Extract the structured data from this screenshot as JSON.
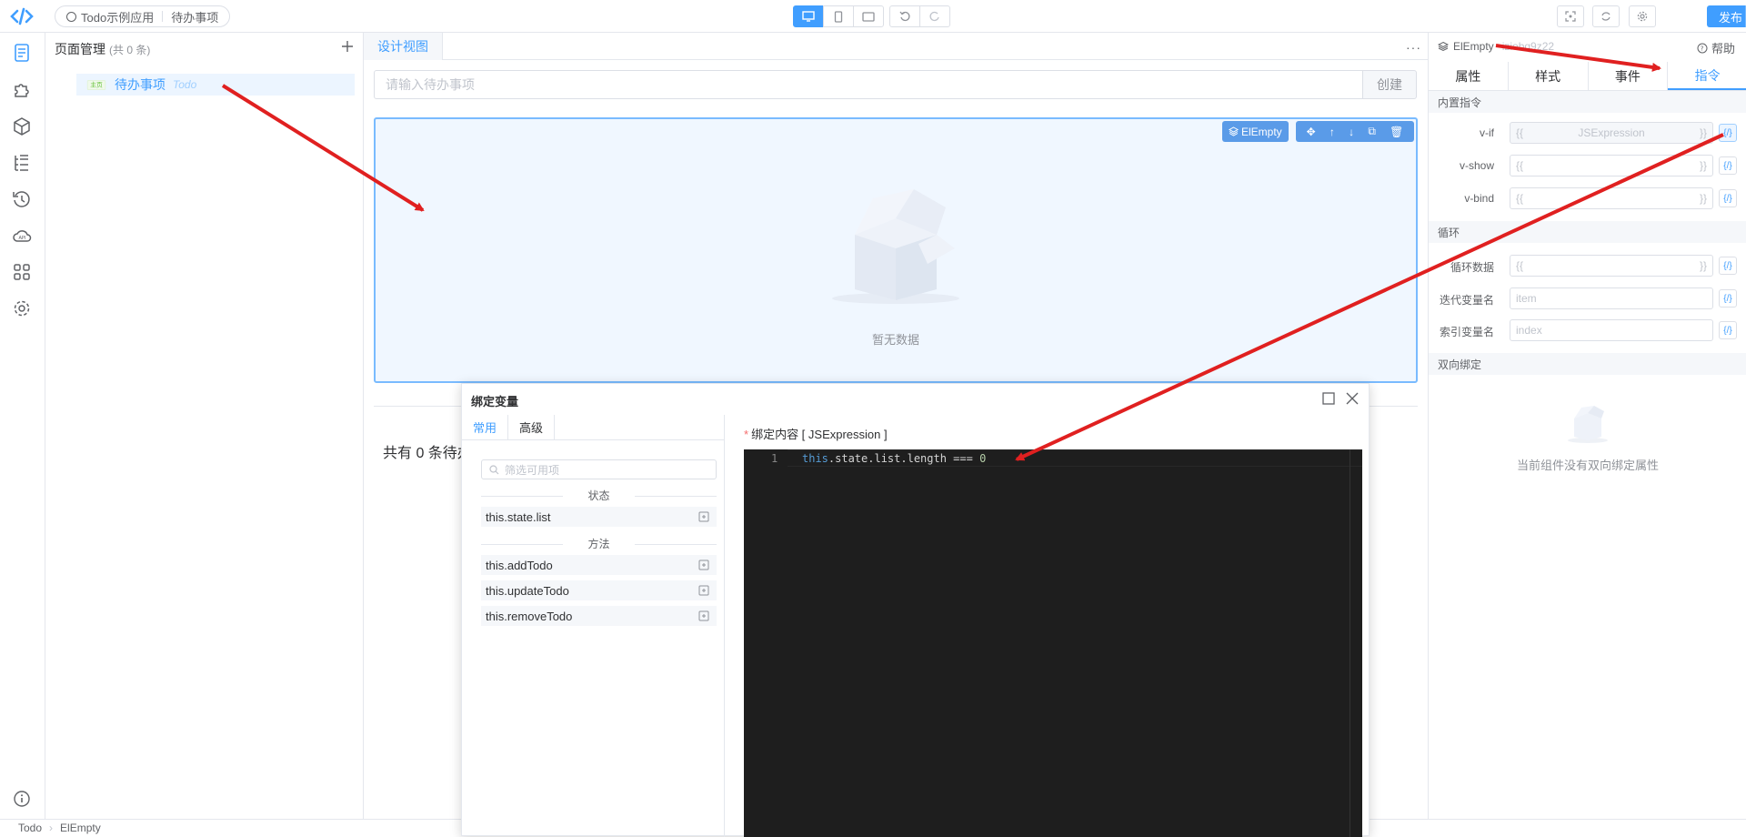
{
  "topbar": {
    "app_name": "Todo示例应用",
    "page_name": "待办事项",
    "publish_label": "发布"
  },
  "page_panel": {
    "title": "页面管理",
    "count": "(共 0 条)",
    "item_badge": "主页",
    "item_name": "待办事项",
    "item_en": "Todo"
  },
  "canvas": {
    "tab_label": "设计视图",
    "more": "···",
    "input_placeholder": "请输入待办事项",
    "create_label": "创建",
    "selected_component": "ElEmpty",
    "empty_text": "暂无数据",
    "count_text": "共有 0 条待办"
  },
  "right_panel": {
    "component": "ElEmpty",
    "component_id": "iziobq9z22",
    "help": "帮助",
    "tabs": [
      "属性",
      "样式",
      "事件",
      "指令"
    ],
    "active_tab": "指令",
    "sec_builtin": "内置指令",
    "rows": [
      {
        "label": "v-if",
        "left": "{{",
        "mid": "JSExpression",
        "right": "}}",
        "disabled": true
      },
      {
        "label": "v-show",
        "left": "{{",
        "mid": "",
        "right": "}}"
      },
      {
        "label": "v-bind",
        "left": "{{",
        "mid": "",
        "right": "}}"
      }
    ],
    "sec_loop": "循环",
    "loop_rows": [
      {
        "label": "循环数据",
        "left": "{{",
        "mid": "",
        "right": "}}"
      },
      {
        "label": "迭代变量名",
        "placeholder": "item"
      },
      {
        "label": "索引变量名",
        "placeholder": "index"
      }
    ],
    "sec_twoway": "双向绑定",
    "no_twoway": "当前组件没有双向绑定属性",
    "bind_btn": "{/}"
  },
  "dialog": {
    "title": "绑定变量",
    "tabs": [
      "常用",
      "高级"
    ],
    "filter_placeholder": "筛选可用项",
    "group_state": "状态",
    "state_items": [
      "this.state.list"
    ],
    "group_methods": "方法",
    "method_items": [
      "this.addTodo",
      "this.updateTodo",
      "this.removeTodo"
    ],
    "bind_label": "绑定内容 [ JSExpression ]",
    "code_line_no": "1",
    "code_this": "this",
    "code_rest": ".state.list.length === ",
    "code_num": "0"
  },
  "statusbar": {
    "crumb1": "Todo",
    "crumb2": "ElEmpty"
  },
  "colors": {
    "accent": "#409eff",
    "arrow": "#e02020"
  }
}
